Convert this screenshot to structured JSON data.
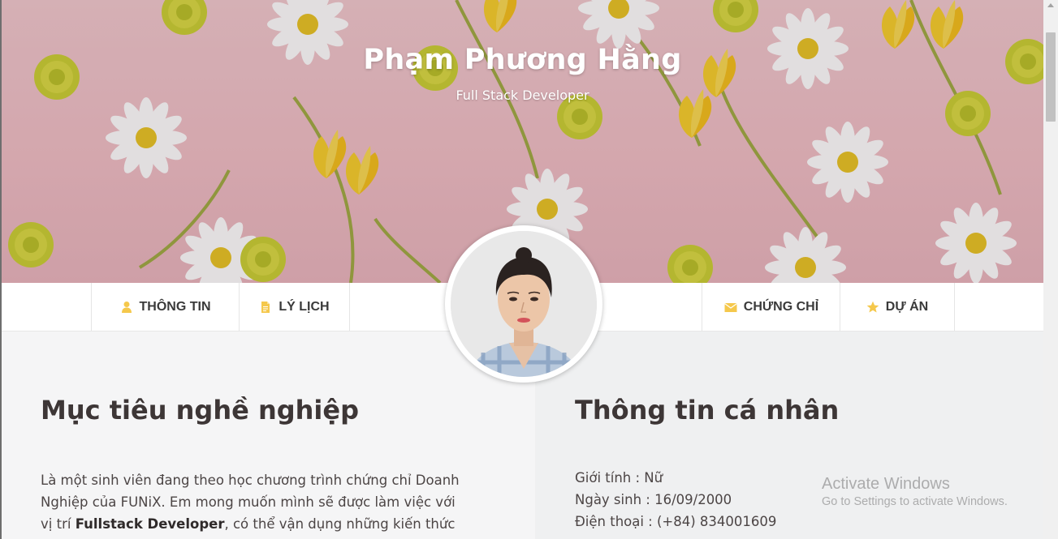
{
  "hero": {
    "name": "Phạm Phương Hằng",
    "role": "Full Stack Developer"
  },
  "nav": {
    "items": [
      {
        "label": "THÔNG TIN",
        "icon": "user-icon"
      },
      {
        "label": "LÝ LỊCH",
        "icon": "document-icon"
      },
      {
        "label": "CHỨNG CHỈ",
        "icon": "envelope-icon"
      },
      {
        "label": "DỰ ÁN",
        "icon": "star-icon"
      }
    ],
    "icon_color": "#f5c84c"
  },
  "career": {
    "title": "Mục tiêu nghề nghiệp",
    "text_1": "Là một sinh viên đang theo học chương trình chứng chỉ Doanh Nghiệp của FUNiX. Em mong muốn mình sẽ được làm việc với vị trí",
    "highlight": "Fullstack Developer",
    "text_2": ", có thể vận dụng những kiến thức đã được"
  },
  "personal": {
    "title": "Thông tin cá nhân",
    "gender": "Giới tính : Nữ",
    "birthday": "Ngày sinh : 16/09/2000",
    "phone": "Điện thoại : (+84) 834001609"
  },
  "watermark": {
    "line1": "Activate Windows",
    "line2": "Go to Settings to activate Windows."
  },
  "colors": {
    "hero_pink": "#efbcc3",
    "text_dark": "#3d3636",
    "page_bg": "#f5f5f6"
  }
}
